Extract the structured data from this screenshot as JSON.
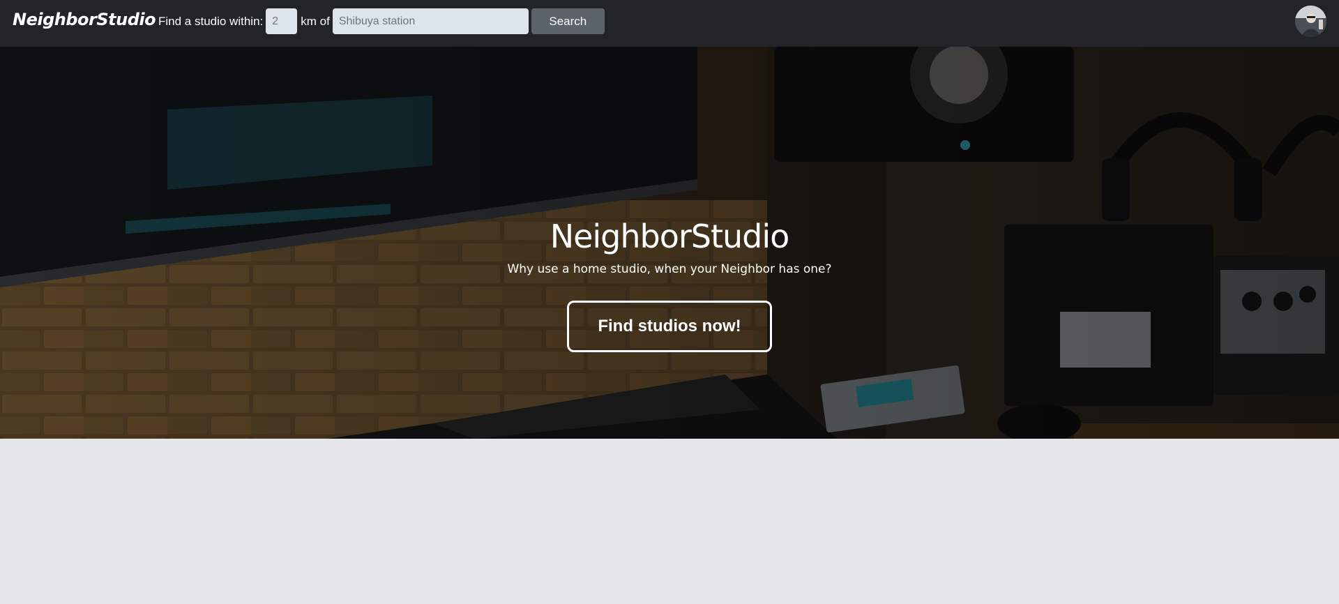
{
  "navbar": {
    "brand": "NeighborStudio",
    "search": {
      "prefix_label": "Find a studio within:",
      "km_placeholder": "2",
      "km_unit_label": "km of",
      "location_placeholder": "Shibuya station",
      "button_label": "Search"
    }
  },
  "hero": {
    "title": "NeighborStudio",
    "subtitle": "Why use a home studio, when your Neighbor has one?",
    "cta_label": "Find studios now!"
  },
  "colors": {
    "navbar_bg": "#212529",
    "input_bg": "#dee4ec",
    "search_button_bg": "#5c636a",
    "page_bg": "#e5e6e9"
  },
  "icons": {
    "avatar": "user-avatar"
  }
}
